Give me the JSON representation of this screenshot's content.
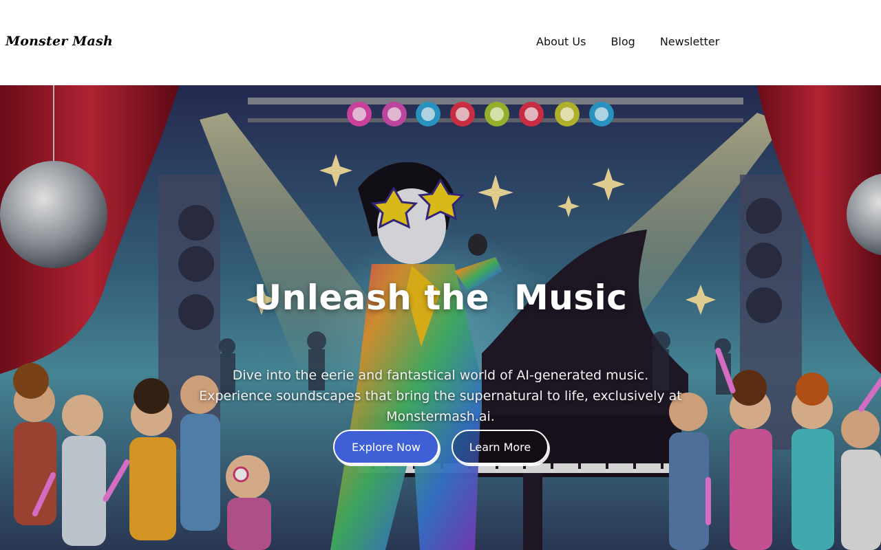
{
  "header": {
    "logo": "Monster Mash",
    "nav": [
      {
        "label": "About Us"
      },
      {
        "label": "Blog"
      },
      {
        "label": "Newsletter"
      }
    ]
  },
  "hero": {
    "title": "Unleash the  Music",
    "subtitle_lines": [
      "Dive into the eerie and fantastical world of AI-generated music.",
      "Experience soundscapes that bring the supernatural to life, exclusively at",
      "Monstermash.ai."
    ],
    "primary_button": "Explore Now",
    "secondary_button": "Learn More"
  },
  "colors": {
    "primary_button": "#3f5fd6",
    "header_background": "#ffffff"
  }
}
